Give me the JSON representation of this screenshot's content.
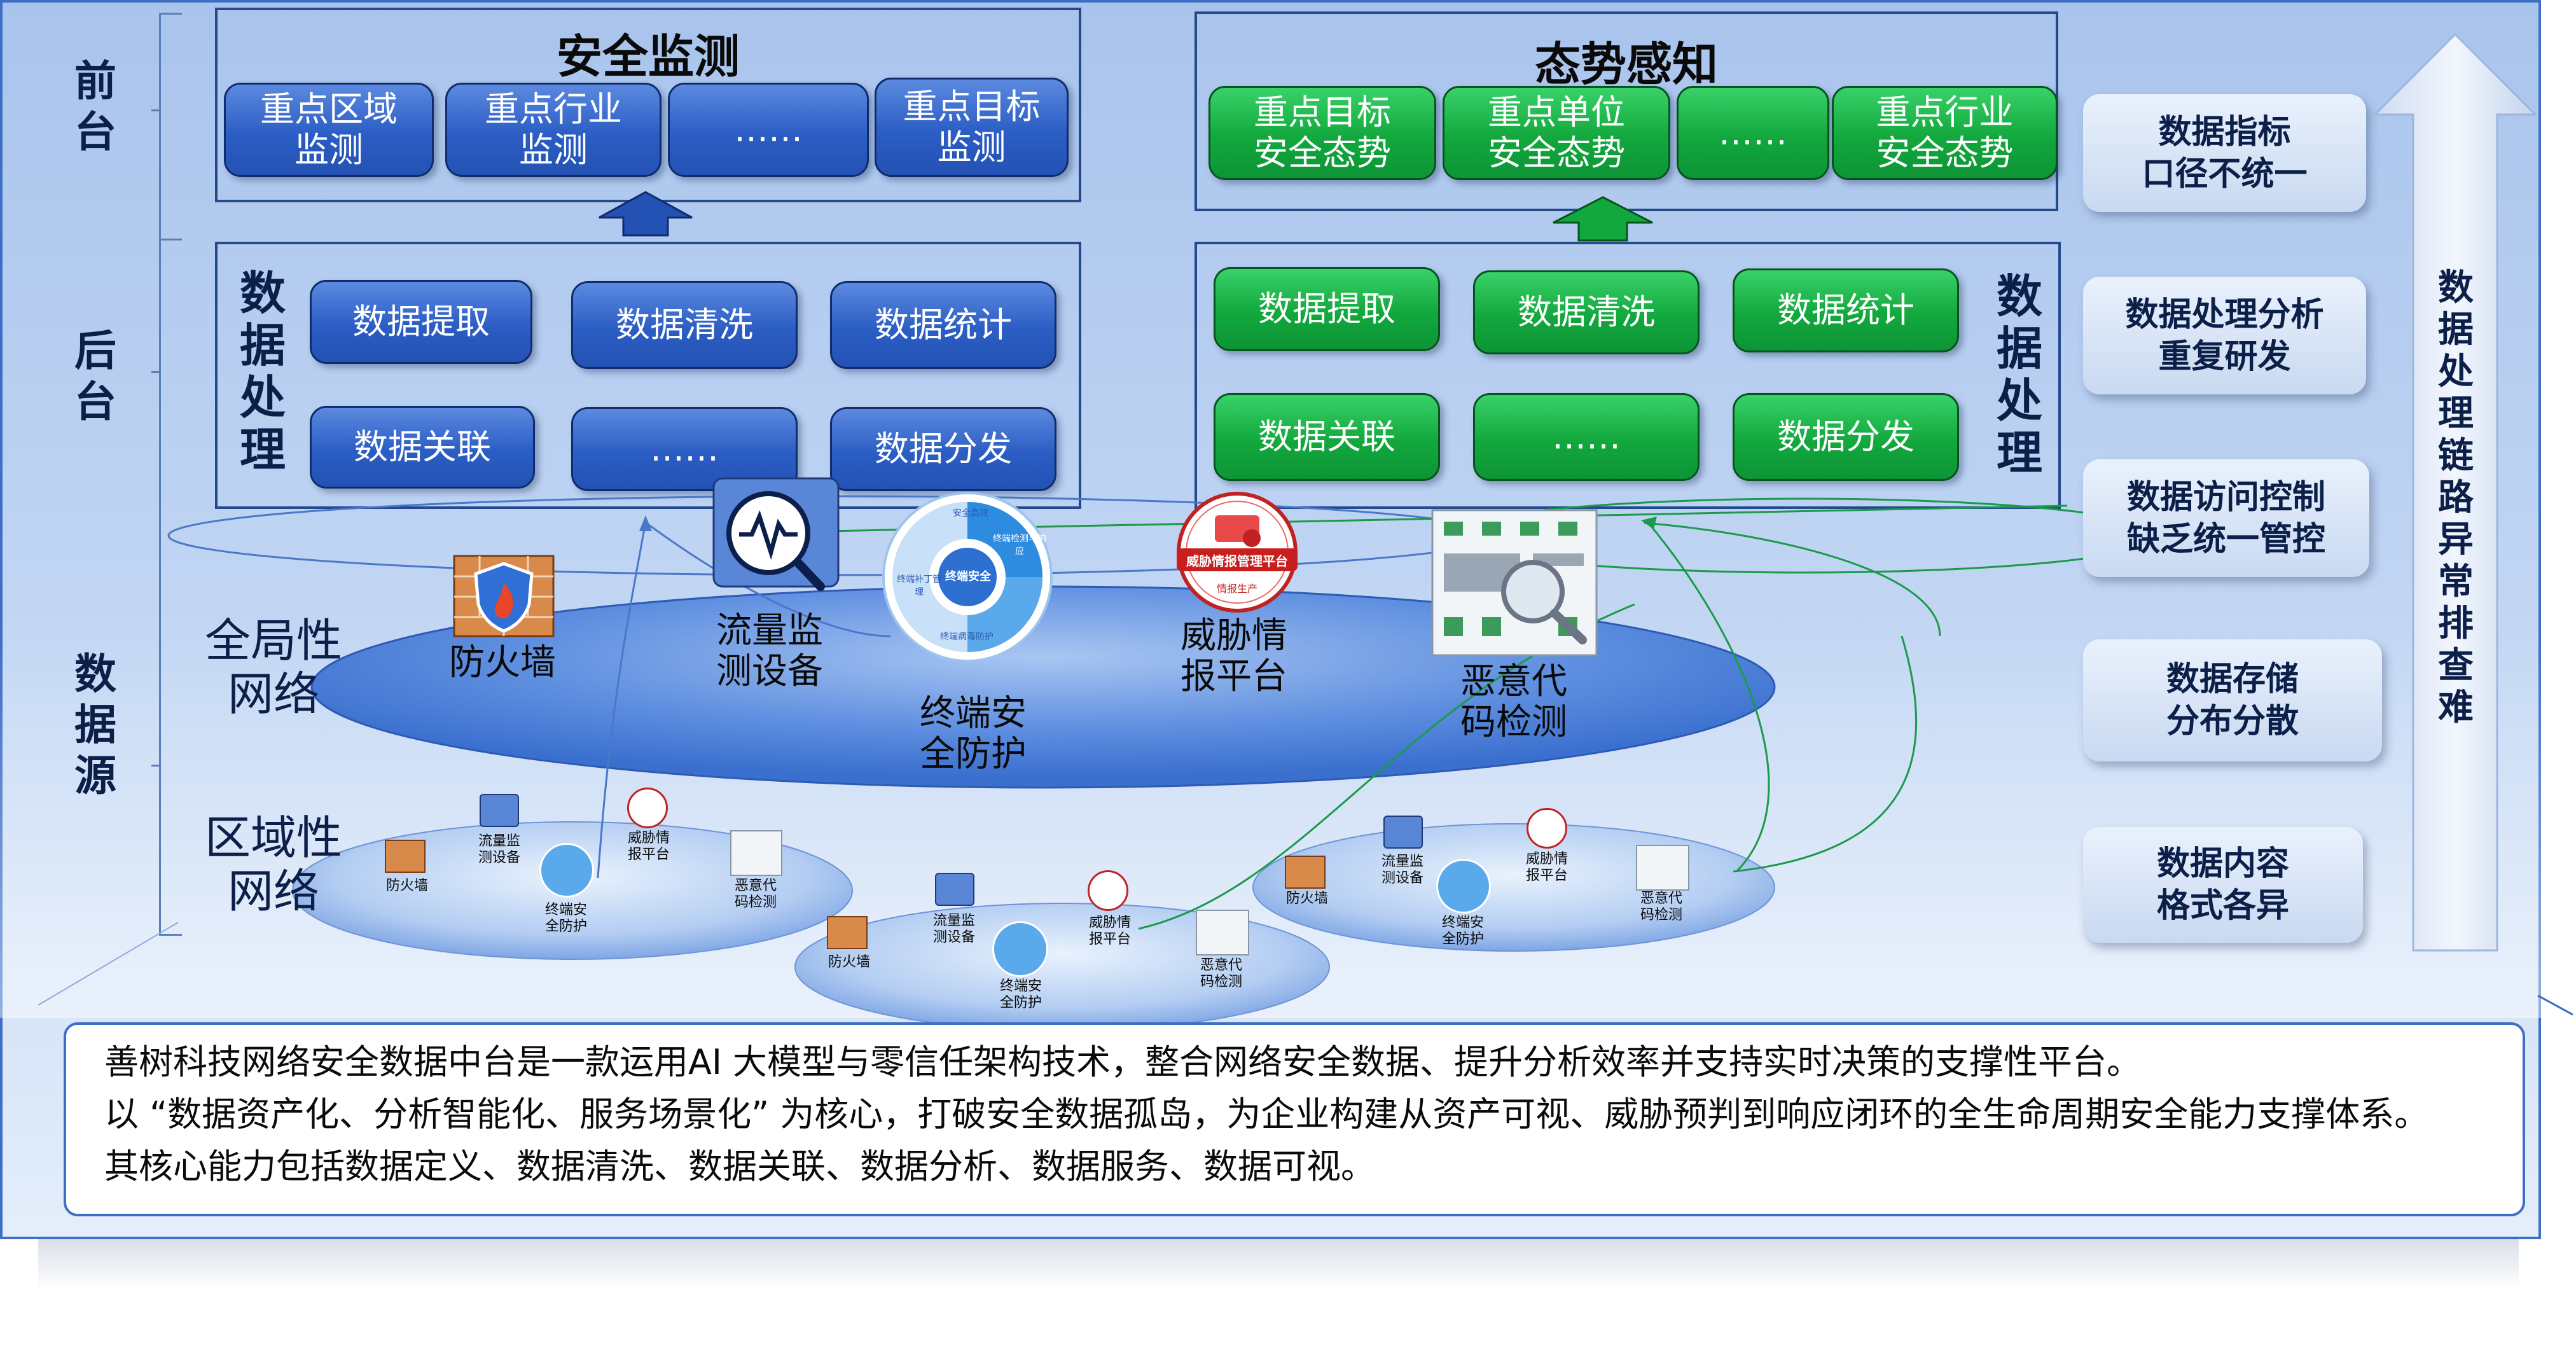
{
  "layers": {
    "front": "前台",
    "back": "后台",
    "source": "数据源"
  },
  "security_monitoring": {
    "title": "安全监测",
    "items": [
      "重点区域\n监测",
      "重点行业\n监测",
      "……",
      "重点目标\n监测"
    ]
  },
  "situation_awareness": {
    "title": "态势感知",
    "items": [
      "重点目标\n安全态势",
      "重点单位\n安全态势",
      "……",
      "重点行业\n安全态势"
    ]
  },
  "processing_left": {
    "title": "数据处理",
    "items": [
      "数据提取",
      "数据清洗",
      "数据统计",
      "数据关联",
      "……",
      "数据分发"
    ]
  },
  "processing_right": {
    "title": "数据处理",
    "items": [
      "数据提取",
      "数据清洗",
      "数据统计",
      "数据关联",
      "……",
      "数据分发"
    ]
  },
  "networks": {
    "global": "全局性\n网络",
    "regional": "区域性\n网络"
  },
  "devices": {
    "firewall": "防火墙",
    "traffic": "流量监\n测设备",
    "endpoint": "终端安\n全防护",
    "threat_intel": "威胁情\n报平台",
    "malware": "恶意代\n码检测"
  },
  "device_inner_text": {
    "threat_intel_badge": "威胁情报管理平台",
    "threat_intel_sub": "情报生产",
    "endpoint_center": "终端安全",
    "endpoint_ring_1": "安全高效",
    "endpoint_ring_2": "终端检测与响应",
    "endpoint_ring_3": "终端补丁管理",
    "endpoint_ring_4": "终端病毒防护"
  },
  "issues": [
    "数据指标\n口径不统一",
    "数据处理分析\n重复研发",
    "数据访问控制\n缺乏统一管控",
    "数据存储\n分布分散",
    "数据内容\n格式各异"
  ],
  "arrow_label": "数据处理链路异常排查难",
  "description": [
    "善树科技网络安全数据中台是一款运用AI 大模型与零信任架构技术，整合网络安全数据、提升分析效率并支持实时决策的支撑性平台。",
    "以 “数据资产化、分析智能化、服务场景化” 为核心，打破安全数据孤岛，为企业构建从资产可视、威胁预判到响应闭环的全生命周期安全能力支撑体系。",
    "其核心能力包括数据定义、数据清洗、数据关联、数据分析、数据服务、数据可视。"
  ],
  "colors": {
    "panel_border": "#3e6fc4",
    "blue_button": "#2b5dc4",
    "green_button": "#12a83d",
    "arrow": "#e8f0fc",
    "frame_border": "#244a8c"
  }
}
